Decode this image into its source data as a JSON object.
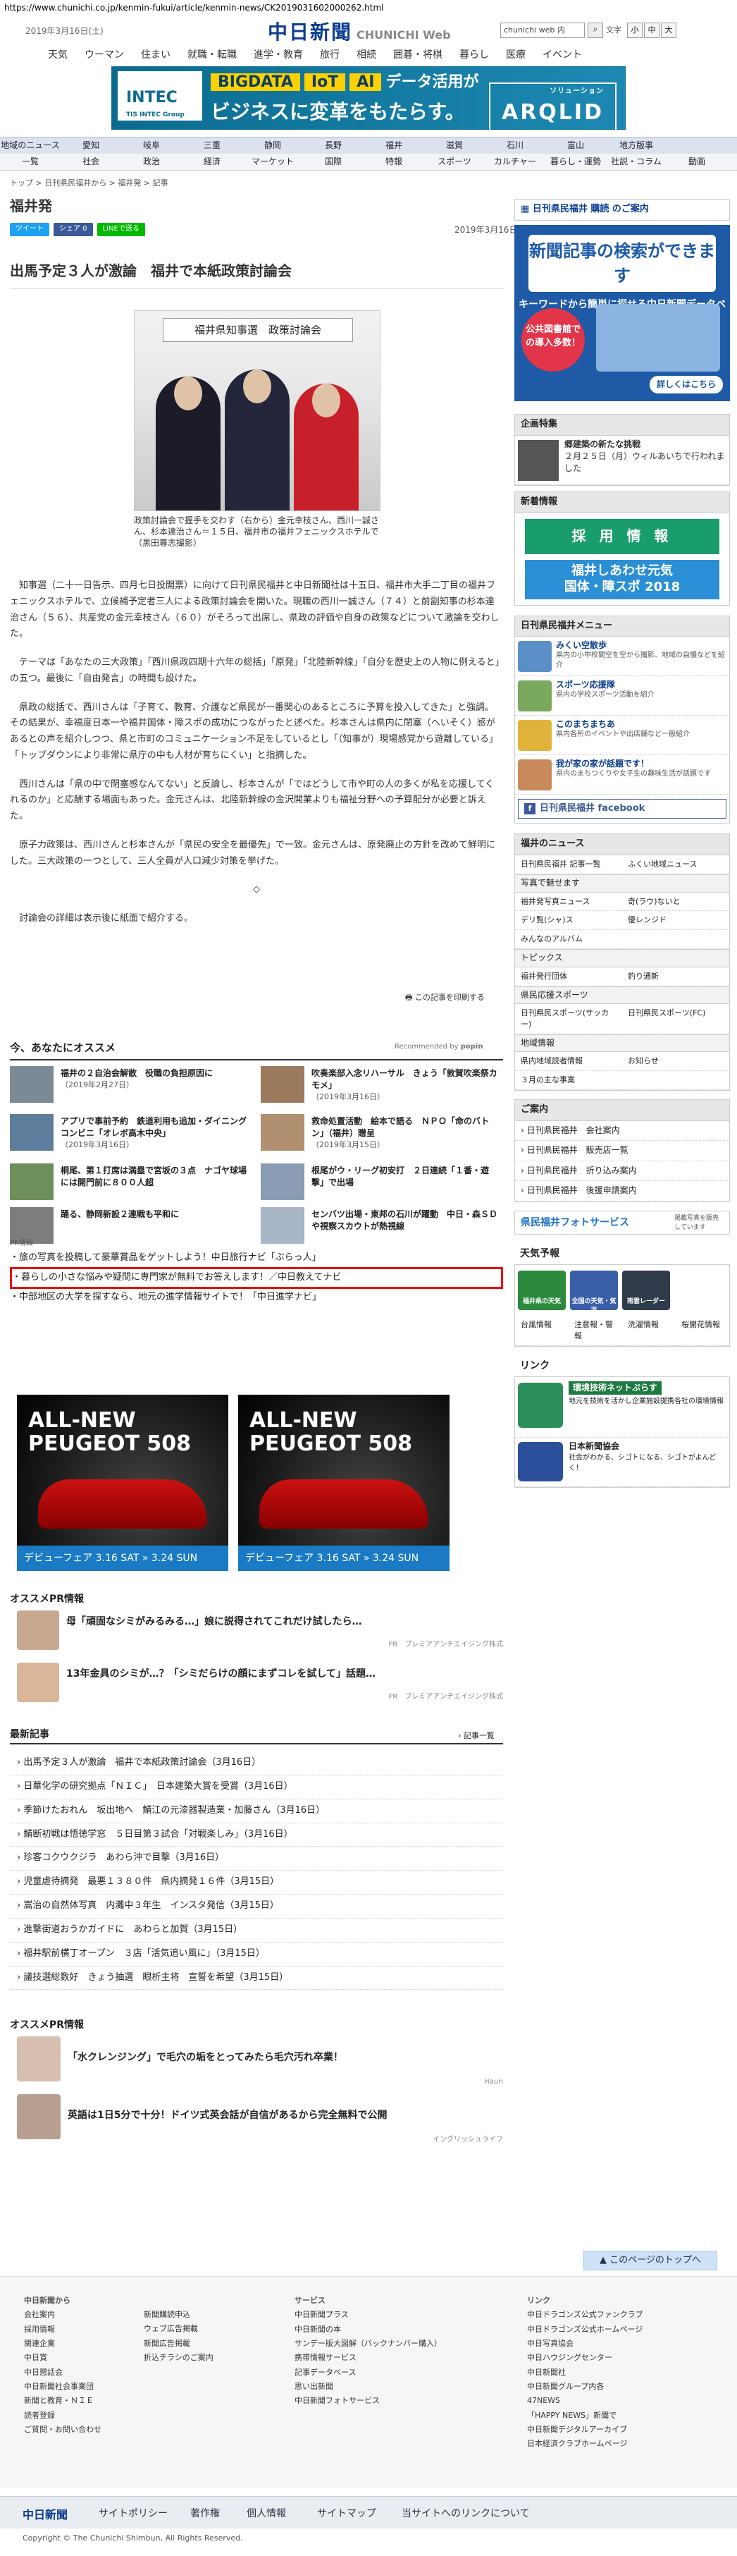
{
  "url": "https://www.chunichi.co.jp/kenmin-fukui/article/kenmin-news/CK2019031602000262.html",
  "header": {
    "date": "2019年3月16日(土)",
    "logo": "中日新聞",
    "logo_sub": "CHUNICHI Web",
    "search_placeholder": "chunichi web 内",
    "size_label": "文字",
    "size_small": "小",
    "size_mid": "中",
    "size_large": "大",
    "nav": [
      "天気",
      "ウーマン",
      "住まい",
      "就職・転職",
      "進学・教育",
      "旅行",
      "相続",
      "囲碁・将棋",
      "暮らし",
      "医療",
      "イベント"
    ]
  },
  "banner": {
    "tags": [
      "BIGDATA",
      "IoT",
      "AI"
    ],
    "line1_tail": "データ活用が",
    "line2": "ビジネスに変革をもたらす。",
    "brand": "INTEC",
    "brand_sub": "TIS INTEC Group",
    "product": "ARQLID",
    "product_sub": "ソリューション"
  },
  "region_nav": [
    "地域のニュース",
    "愛知",
    "岐阜",
    "三重",
    "静岡",
    "長野",
    "福井",
    "滋賀",
    "石川",
    "富山",
    "地方版事"
  ],
  "genre_nav": [
    "一覧",
    "社会",
    "政治",
    "経済",
    "マーケット",
    "国際",
    "特報",
    "スポーツ",
    "カルチャー",
    "暮らし・運勢",
    "社説・コラム",
    "動画"
  ],
  "breadcrumb": "トップ > 日刊県民福井から > 福井発 > 記事",
  "section_title": "福井発",
  "share": {
    "tweet": "ツイート",
    "facebook": "シェア 0",
    "line": "LINEで送る"
  },
  "article": {
    "date": "2019年3月16日",
    "headline": "出馬予定３人が激論　福井で本紙政策討論会",
    "sign_text": "福井県知事選　政策討論会",
    "caption": "政策討論会で握手を交わす（右から）金元幸枝さん、西川一誠さん、杉本達治さん＝１５日、福井市の福井フェニックスホテルで（黒田尊志撮影）",
    "paragraphs": [
      "知事選（二十一日告示、四月七日投開票）に向けて日刊県民福井と中日新聞社は十五日、福井市大手二丁目の福井フェニックスホテルで、立候補予定者三人による政策討論会を開いた。現職の西川一誠さん（７４）と前副知事の杉本達治さん（５６）、共産党の金元幸枝さん（６０）がそろって出席し、県政の評価や自身の政策などについて激論を交わした。",
      "テーマは「あなたの三大政策」「西川県政四期十六年の総括」「原発」「北陸新幹線」「自分を歴史上の人物に例えると」の五つ。最後に「自由発言」の時間も設けた。",
      "県政の総括で、西川さんは「子育て、教育、介護など県民が一番関心のあるところに予算を投入してきた」と強調。その結果が、幸福度日本一や福井国体・障スポの成功につながったと述べた。杉本さんは県内に閉塞（へいそく）感があるとの声を紹介しつつ、県と市町のコミュニケーション不足をしているとし「（知事が）現場感覚から遊離している」「トップダウンにより非常に県庁の中も人材が育ちにくい」と指摘した。",
      "西川さんは「県の中で閉塞感なんてない」と反論し、杉本さんが「ではどうして市や町の人の多くが私を応援してくれるのか」と応酬する場面もあった。金元さんは、北陸新幹線の金沢開業よりも福祉分野への予算配分が必要と訴えた。",
      "原子力政策は、西川さんと杉本さんが「県民の安全を最優先」で一致。金元さんは、原発廃止の方針を改めて鮮明にした。三大政策の一つとして、三人全員が人口減少対策を挙げた。",
      "◇",
      "討論会の詳細は表示後に紙面で紹介する。"
    ],
    "print": "この記事を印刷する"
  },
  "osusume": {
    "title": "今、あなたにオススメ",
    "recommended_by": "Recommended by",
    "popin": "popin",
    "items": [
      {
        "title": "福井の２自治会解散　役職の負担原因に",
        "date": "（2019年2月27日）"
      },
      {
        "title": "吹奏楽部入念リハーサル　きょう「敦賀吹楽祭カモメ」",
        "date": "（2019年3月16日）"
      },
      {
        "title": "アプリで事前予約　鉄道利用も追加・ダイニングコンビニ「オレボ高木中央」",
        "date": "（2019年3月16日）"
      },
      {
        "title": "救命処置活動　絵本で語る　ＮＰＯ「命のバトン」（福井）贈呈",
        "date": "（2019年3月15日）"
      },
      {
        "title": "桐尾、第１打席は満塁で宮坂の３点　ナゴヤ球場には開門前に８００人超",
        "date": ""
      },
      {
        "title": "根尾がウ・リーグ初安打　２日連続「１番・遊撃」で出場",
        "date": ""
      },
      {
        "title": "踊る、静岡新設２連戦も平和に",
        "date": ""
      },
      {
        "title": "センバツ出場・東邦の石川が躍動　中日・森ＳＤや視察スカウトが熱視線",
        "date": ""
      }
    ]
  },
  "pr": {
    "label": "PR情報",
    "links": [
      "旅の写真を投稿して豪華賞品をゲットしよう！中日旅行ナビ「ぶらっ人」",
      "暮らしの小さな悩みや疑問に専門家が無料でお答えします！／中日教えてナビ",
      "中部地区の大学を探すなら、地元の進学情報サイトで！「中日進学ナビ」"
    ]
  },
  "peugeot_ads": [
    {
      "line1": "ALL-NEW",
      "line2": "PEUGEOT 508",
      "foot": "デビューフェア 3.16 SAT » 3.24 SUN"
    },
    {
      "line1": "ALL-NEW",
      "line2": "PEUGEOT 508",
      "foot": "デビューフェア 3.16 SAT » 3.24 SUN"
    }
  ],
  "pr2": {
    "title": "オススメPR情報",
    "items": [
      {
        "text": "母「頑固なシミがみるみる…」娘に説得されてこれだけ試したら…",
        "src": "PR　プレミアアンチエイジング株式"
      },
      {
        "text": "13年金具のシミが…？「シミだらけの顔にまずコレを試して」話題…",
        "src": "PR　プレミアアンチエイジング株式"
      }
    ]
  },
  "latest": {
    "title": "最新記事",
    "list_link": "記事一覧",
    "items": [
      "出馬予定３人が激論　福井で本紙政策討論会（3月16日）",
      "日華化学の研究拠点「ＮＩＣ」　日本建築大賞を受賞（3月16日）",
      "季節けたおれん　坂出地へ　鯖江の元漆器製造業・加藤さん（3月16日）",
      "鯖断初戦は悟徳学窓　５日目第３試合「対戦楽しみ」（3月16日）",
      "珍客コクウクジラ　あわら沖で目撃（3月16日）",
      "児童虐待摘発　最悪１３８０件　県内摘発１６件（3月15日）",
      "嵩治の自然体写真　内灘中３年生　インスタ発信（3月15日）",
      "進撃街道おうかガイドに　あわらと加賀（3月15日）",
      "福井駅前横丁オープン　３店「活気追い風に」（3月15日）",
      "議技選総数好　きょう抽選　眼析主将　宣誓を希望（3月15日）"
    ]
  },
  "pr3": {
    "title": "オススメPR情報",
    "items": [
      {
        "text": "「水クレンジング」で毛穴の垢をとってみたら毛穴汚れ卒業！",
        "src": "Hauri"
      },
      {
        "text": "英語は1日5分で十分！ドイツ式英会話が自信があるから完全無料で公開",
        "src": "イングリッシュライフ"
      }
    ]
  },
  "page_top": "このページのトップへ",
  "sidebar": {
    "kodoku": "日刊県民福井 購読 のご案内",
    "kensaku": {
      "title": "新聞記事の検索ができます",
      "sub": "キーワードから簡単に探せる中日新聞データベース",
      "badge": "公共図書館での導入多数！",
      "more": "詳しくはこちら"
    },
    "kikaku": {
      "title": "企画特集",
      "item_title": "郷建築の新たな挑戦",
      "item_text": "２月２５日（月）ウィルあいちで行われました"
    },
    "shinsotsu": {
      "title": "新着情報",
      "saiyo": "採 用 情 報",
      "shiawase1": "福井しあわせ元気",
      "shiawase2": "国体・障スポ 2018"
    },
    "menu": {
      "title": "日刊県民福井メニュー",
      "items": [
        {
          "title": "みくい空散歩",
          "desc": "県内の小中校間空を空から撮影、地域の自慢などを紹介"
        },
        {
          "title": "スポーツ応援隊",
          "desc": "県内の学校スポーツ活動を紹介"
        },
        {
          "title": "このまちまちあ",
          "desc": "県内各所のイベントや出店舗など一般紹介"
        },
        {
          "title": "我が家の家が話題です！",
          "desc": "県内のまちつくりや女子生の趣味生活が話題です"
        }
      ],
      "facebook": "日刊県民福井 facebook"
    },
    "news": {
      "title": "福井のニュース",
      "grid1": [
        "日刊県民福井 記事一覧",
        "ふくい地域ニュース"
      ],
      "photo": "写真で魅せます",
      "grid2": [
        "福井発写真ニュース",
        "奇(ラウ)ないと",
        "デリ覧(シャ)ス",
        "優レンジド",
        "みんなのアルバム",
        ""
      ],
      "topics": "トピックス",
      "grid3": [
        "福井発行団体",
        "釣り通新"
      ],
      "sports": "県民応援スポーツ",
      "grid4": [
        "日刊県民スポーツ(サッカー)",
        "日刊県民スポーツ(FC)"
      ],
      "chiiki": "地域情報",
      "grid5": [
        "県内地域読者情報",
        "お知らせ",
        "３月の主な事業",
        ""
      ]
    },
    "annai": {
      "title": "ご案内",
      "items": [
        "日刊県民福井　会社案内",
        "日刊県民福井　販売店一覧",
        "日刊県民福井　折り込み案内",
        "日刊県民福井　後援申請案内"
      ]
    },
    "photoservice": "県民福井フォトサービス",
    "photoservice_sub": "掲載写真を販売しています",
    "weather": {
      "title": "天気予報",
      "icons": [
        "福井県の天気",
        "全国の天気・気温",
        "雨雲レーダー"
      ],
      "grid": [
        "台風情報",
        "注意報・警報",
        "洗濯情報",
        "桜開花情報"
      ]
    },
    "link": {
      "title": "リンク",
      "ad1_title": "環境技術ネットぷらす",
      "ad1_text": "地元を技術を活かし企業施設提携各社の環境情報",
      "ad2_title": "日本新聞協会",
      "ad2_text": "社会がわかる、シゴトになる、シゴトがよんどく！"
    }
  },
  "footer": {
    "cols": [
      {
        "head": "中日新聞から",
        "items": [
          "会社案内",
          "採用情報",
          "関連企業",
          "中日賞",
          "中日懇話会",
          "中日新聞社会事業団",
          "新聞と教育・ＮＩＥ",
          "読者登録",
          "ご質問・お問い合わせ"
        ]
      },
      {
        "head": "",
        "items": [
          "新聞購読申込",
          "ウェブ広告掲載",
          "新聞広告掲載",
          "折込チラシのご案内"
        ]
      },
      {
        "head": "サービス",
        "items": [
          "中日新聞プラス",
          "中日新聞の本",
          "サンデー版大図解（バックナンバー購入）",
          "携帯情報サービス",
          "記事データベース",
          "思い出新聞",
          "中日新聞フォトサービス"
        ]
      },
      {
        "head": "リンク",
        "items": [
          "中日ドラゴンズ公式ファンクラブ",
          "中日ドラゴンズ公式ホームページ",
          "中日写真協会",
          "中日ハウジングセンター",
          "中日新聞社",
          "中日新聞グループ内各",
          "47NEWS",
          "「HAPPY NEWS」新聞で",
          "中日新聞デジタルアーカイブ",
          "日本経済クラブホームページ"
        ]
      }
    ],
    "bar": [
      "中日新聞",
      "サイトポリシー",
      "著作権",
      "個人情報",
      "サイトマップ",
      "当サイトへのリンクについて"
    ],
    "copyright": "Copyright © The Chunichi Shimbun, All Rights Reserved."
  }
}
